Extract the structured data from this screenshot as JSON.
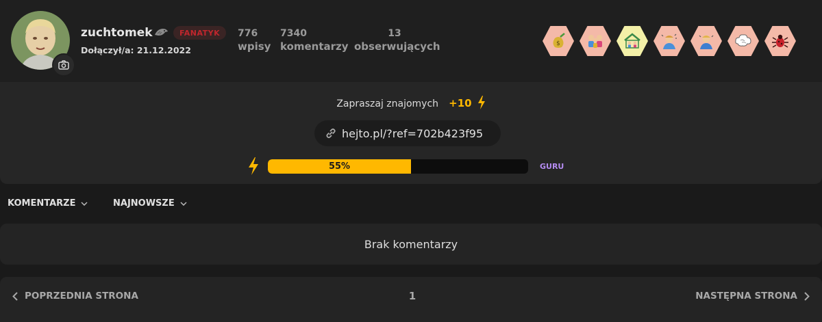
{
  "profile": {
    "username": "zuchtomek",
    "rank": "FANATYK",
    "joined": "Dołączył/a: 21.12.2022",
    "icons": {
      "avatar": "user-photo",
      "camera": "camera-icon",
      "rank_symbol": "bird-icon"
    }
  },
  "stats": {
    "entries": {
      "value": "776",
      "label": "wpisy"
    },
    "comments": {
      "value": "7340",
      "label": "komentarzy"
    },
    "followers": {
      "value": "13",
      "label": "obserwujących"
    }
  },
  "badges": [
    {
      "icon": "money-bag-badge",
      "color": "#f4b9a8"
    },
    {
      "icon": "group-people-badge",
      "color": "#f4b9a8"
    },
    {
      "icon": "community-house-badge",
      "color": "#f3f0a8"
    },
    {
      "icon": "person-sparkles-badge",
      "color": "#f4b9a8"
    },
    {
      "icon": "person-blue-badge",
      "color": "#f4b9a8"
    },
    {
      "icon": "brain-cloud-badge",
      "color": "#f4b9a8"
    },
    {
      "icon": "red-bug-badge",
      "color": "#f4b9a8"
    }
  ],
  "invite": {
    "text": "Zapraszaj znajomych",
    "bonus": "+10",
    "link": "hejto.pl/?ref=702b423f95"
  },
  "progress": {
    "value": 0.55,
    "label": "55%",
    "next_level": "GURU"
  },
  "sorting": {
    "type_label": "KOMENTARZE",
    "order_label": "NAJNOWSZE"
  },
  "comments": {
    "empty_text": "Brak komentarzy"
  },
  "pagination": {
    "prev_label": "POPRZEDNIA STRONA",
    "current_page": "1",
    "next_label": "NASTĘPNA STRONA"
  },
  "colors": {
    "accent": "#ffb800",
    "rank": "#c0262d",
    "level": "#b58cf2",
    "background": "#1a1a1a"
  }
}
